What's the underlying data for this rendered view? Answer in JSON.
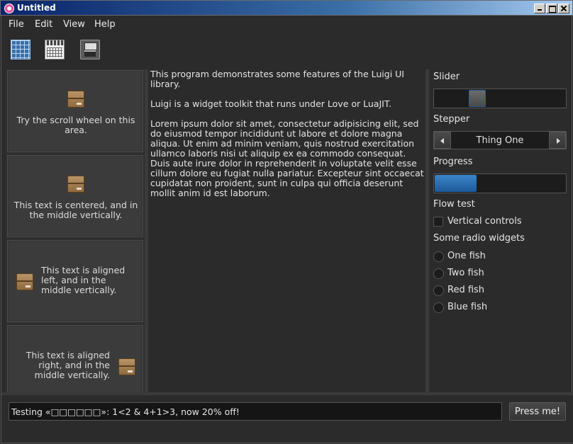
{
  "window": {
    "title": "Untitled"
  },
  "menu": [
    "File",
    "Edit",
    "View",
    "Help"
  ],
  "toolbar": {
    "icons": [
      "grid-icon",
      "calendar-icon",
      "disk-icon"
    ]
  },
  "cards": [
    {
      "text": "Try the scroll wheel on this area."
    },
    {
      "text": "This text is centered, and in the middle vertically."
    },
    {
      "text": "This text is aligned left, and in the middle vertically."
    },
    {
      "text": "This text is aligned right, and in the middle vertically."
    }
  ],
  "center_text": [
    "This program demonstrates some features of the Luigi UI library.",
    "Luigi is a widget toolkit that runs under Love or LuaJIT.",
    "Lorem ipsum dolor sit amet, consectetur adipisicing elit, sed do eiusmod tempor incididunt ut labore et dolore magna aliqua. Ut enim ad minim veniam, quis nostrud exercitation ullamco laboris nisi ut aliquip ex ea commodo consequat. Duis aute irure dolor in reprehenderit in voluptate velit esse cillum dolore eu fugiat nulla pariatur. Excepteur sint occaecat cupidatat non proident, sunt in culpa qui officia deserunt mollit anim id est laborum."
  ],
  "controls": {
    "slider_label": "Slider",
    "slider_value": 0.3,
    "stepper_label": "Stepper",
    "stepper_value": "Thing One",
    "progress_label": "Progress",
    "progress_value": 0.32,
    "flow_label": "Flow test",
    "vertical_label": "Vertical controls",
    "radio_title": "Some radio widgets",
    "radios": [
      "One fish",
      "Two fish",
      "Red fish",
      "Blue fish"
    ]
  },
  "footer": {
    "input_value": "Testing «□□□□□□»: 1<2 & 4+1>3, now 20% off!",
    "button_label": "Press me!"
  }
}
